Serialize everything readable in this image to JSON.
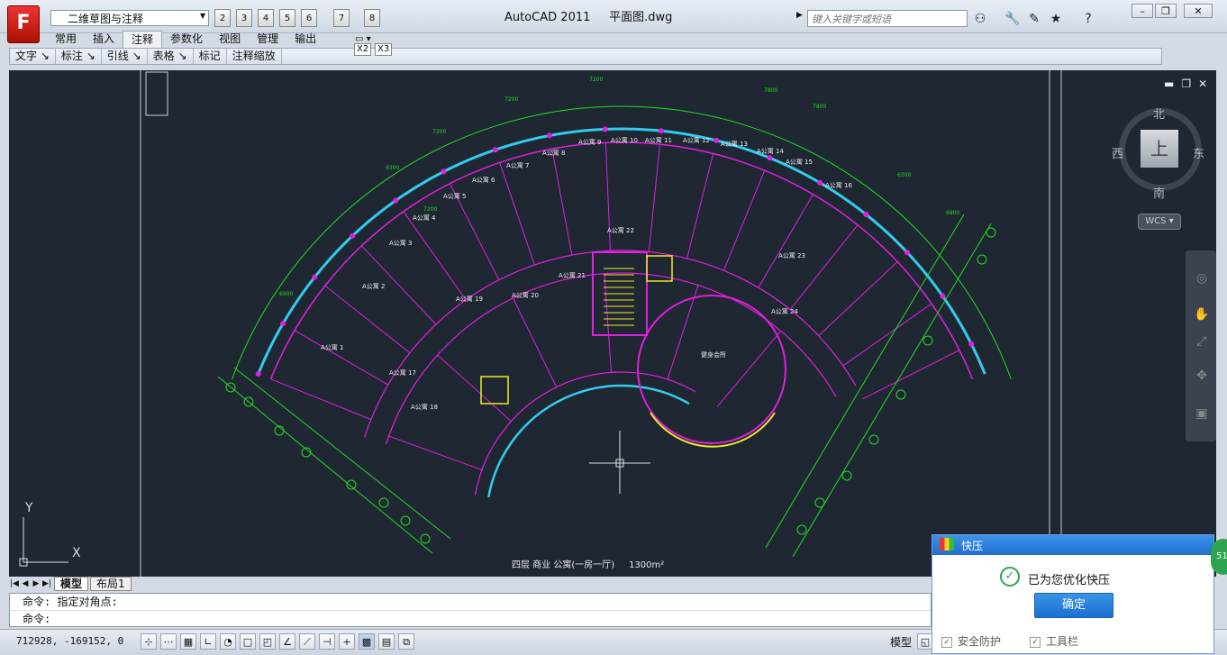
{
  "app": {
    "logo": "F",
    "title": "AutoCAD 2011",
    "filename": "平面图.dwg",
    "workspace": "二维草图与注释",
    "search_placeholder": "键入关键字或短语"
  },
  "quick_access": [
    "2",
    "3",
    "4",
    "5",
    "6",
    "7",
    "8"
  ],
  "ribbon": {
    "tabs": [
      "常用",
      "插入",
      "注释",
      "参数化",
      "视图",
      "管理",
      "输出"
    ],
    "active_tab": "注释",
    "panels": [
      "文字",
      "标注",
      "引线",
      "表格",
      "标记",
      "注释缩放"
    ],
    "extra": [
      "X2",
      "X3"
    ]
  },
  "viewport": {
    "controls": [
      "▬",
      "❐",
      "✕"
    ],
    "viewcube": {
      "top": "上",
      "north": "北",
      "south": "南",
      "east": "东",
      "west": "西"
    },
    "wcs": "WCS",
    "ucs": {
      "x": "X",
      "y": "Y"
    }
  },
  "drawing": {
    "rooms": [
      "A公寓 1",
      "A公寓 2",
      "A公寓 3",
      "A公寓 4",
      "A公寓 5",
      "A公寓 6",
      "A公寓 7",
      "A公寓 8",
      "A公寓 9",
      "A公寓 10",
      "A公寓 11",
      "A公寓 12",
      "A公寓 13",
      "A公寓 14",
      "A公寓 15",
      "A公寓 16",
      "A公寓 17",
      "A公寓 18",
      "A公寓 19",
      "A公寓 20",
      "A公寓 21",
      "A公寓 22",
      "A公寓 23",
      "A公寓 24",
      "健身会所"
    ],
    "dimensions": [
      "7200",
      "7200",
      "7800",
      "7800",
      "7200",
      "7200",
      "6300",
      "6300",
      "6900",
      "6900"
    ],
    "caption": "四层 商业 公寓(一房一厅)",
    "caption_area": "1300m²"
  },
  "layout_tabs": [
    "模型",
    "布局1"
  ],
  "active_layout": "模型",
  "command_lines": [
    "命令: 指定对角点:",
    "命令:"
  ],
  "status": {
    "coords": "712928,  -169152,  0",
    "model": "模型"
  },
  "popup": {
    "title": "快压",
    "message": "已为您优化快压",
    "ok": "确定",
    "options": [
      "安全防护",
      "工具栏"
    ],
    "badge": "51"
  },
  "colors": {
    "canvas": "#1f2733",
    "magenta": "#e020e0",
    "green": "#22dd22",
    "cyan": "#33ccee",
    "yellow": "#eeee22"
  }
}
